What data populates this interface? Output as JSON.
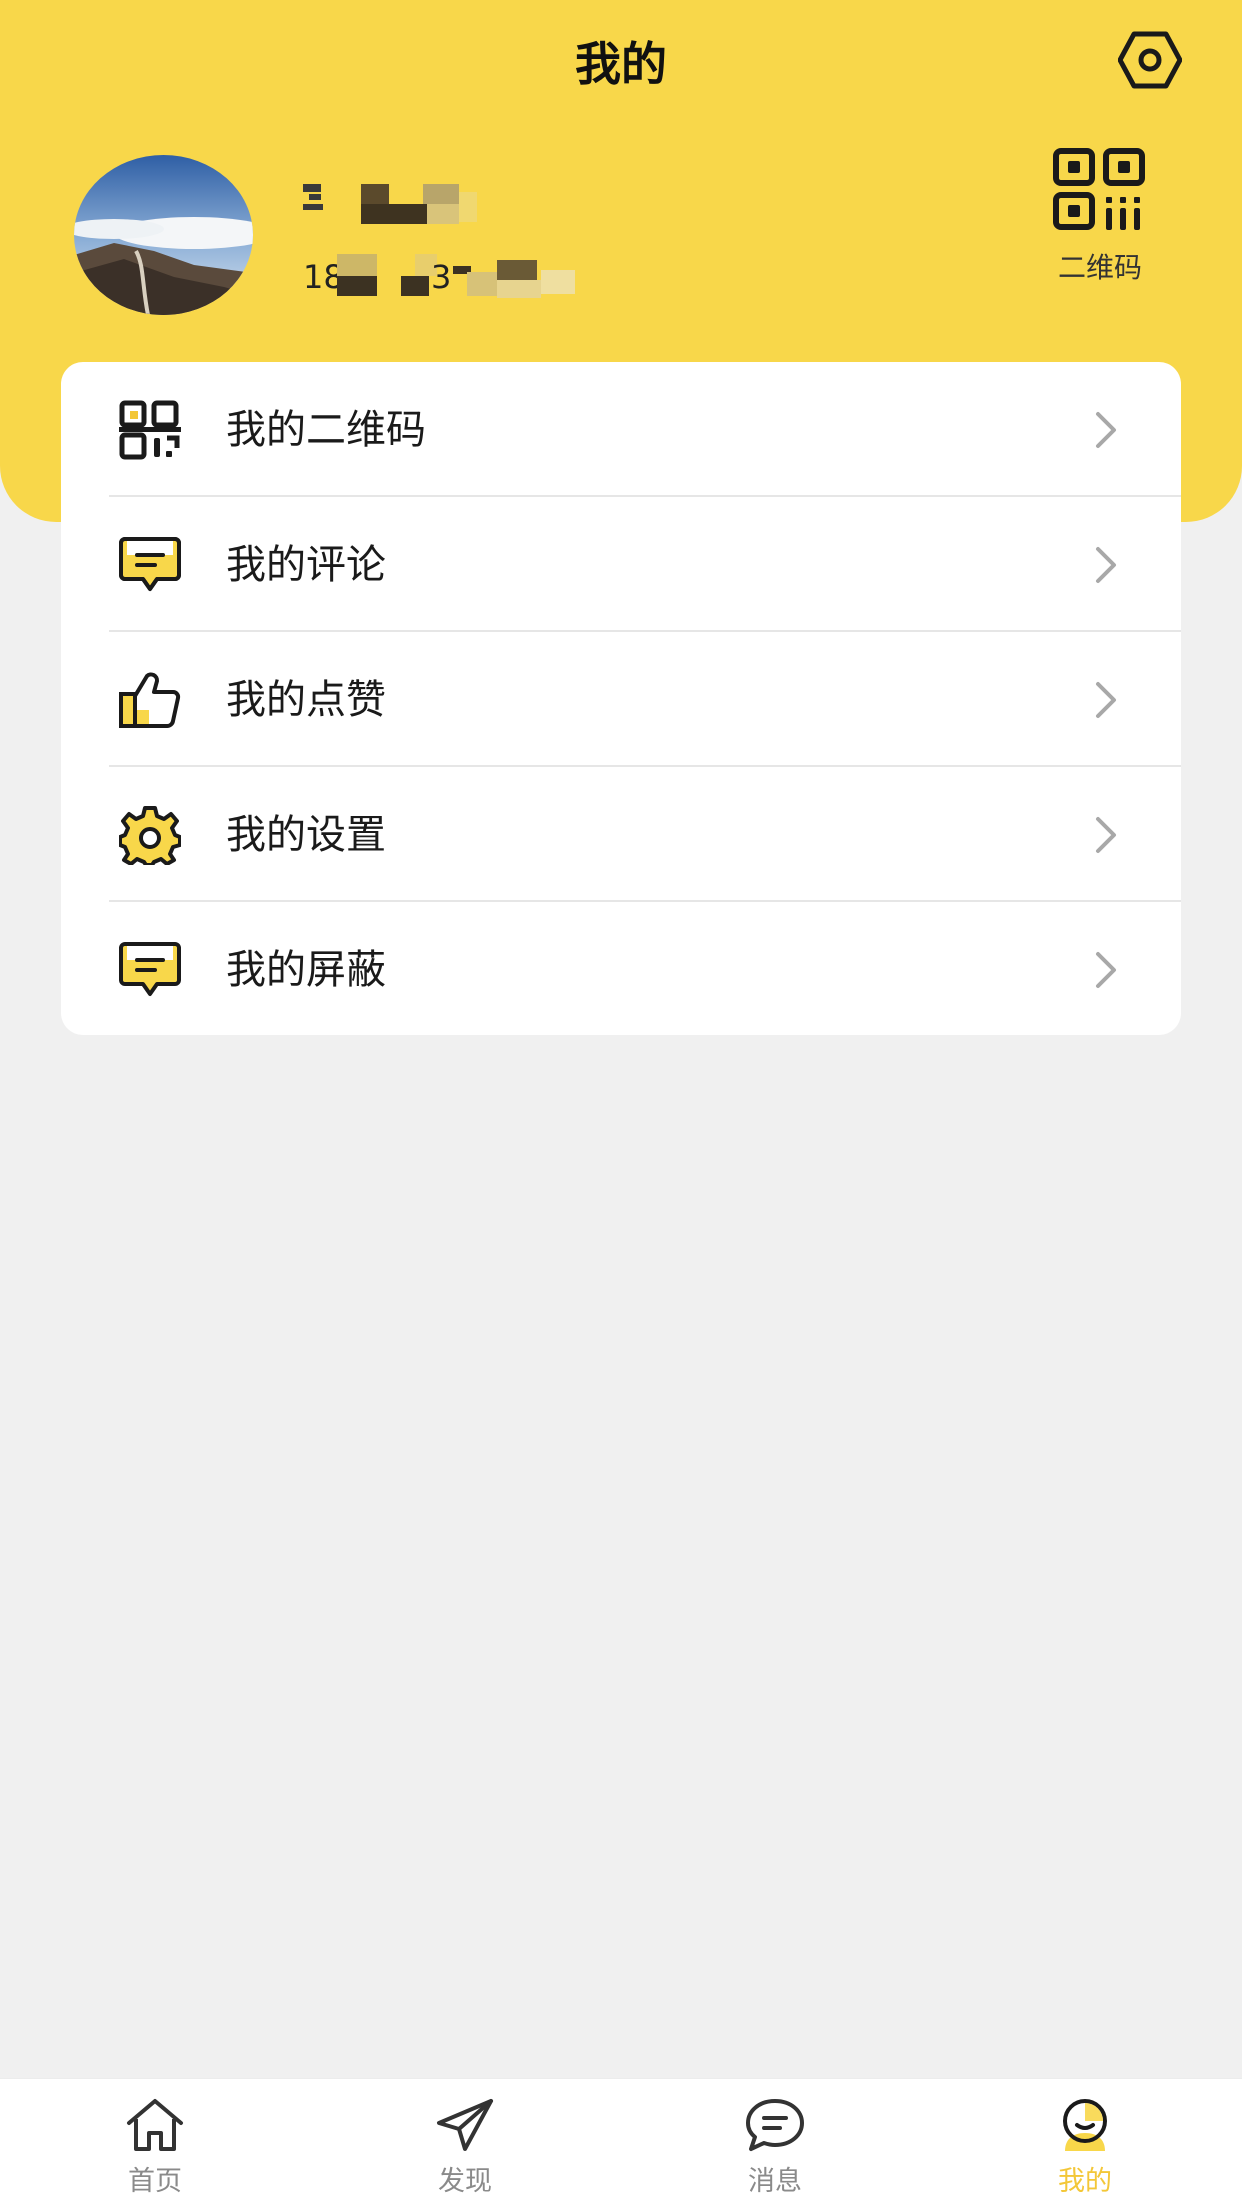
{
  "header": {
    "title": "我的",
    "settings_icon": "hexagon-settings-icon"
  },
  "profile": {
    "name": "",
    "phone": "18",
    "phone_tail": "3",
    "avatar": "landscape-photo-avatar",
    "qr_label": "二维码"
  },
  "menu": {
    "items": [
      {
        "label": "我的二维码",
        "icon": "qr-code-icon"
      },
      {
        "label": "我的评论",
        "icon": "comment-icon"
      },
      {
        "label": "我的点赞",
        "icon": "thumbs-up-icon"
      },
      {
        "label": "我的设置",
        "icon": "gear-icon"
      },
      {
        "label": "我的屏蔽",
        "icon": "block-message-icon"
      }
    ]
  },
  "tabbar": {
    "tabs": [
      {
        "label": "首页",
        "icon": "home-icon",
        "active": false
      },
      {
        "label": "发现",
        "icon": "paper-plane-icon",
        "active": false
      },
      {
        "label": "消息",
        "icon": "chat-bubble-icon",
        "active": false
      },
      {
        "label": "我的",
        "icon": "user-icon",
        "active": true
      }
    ]
  },
  "colors": {
    "accent": "#f8d74a",
    "accent_dark": "#f3c738",
    "background": "#f0f0f0",
    "card": "#ffffff"
  }
}
